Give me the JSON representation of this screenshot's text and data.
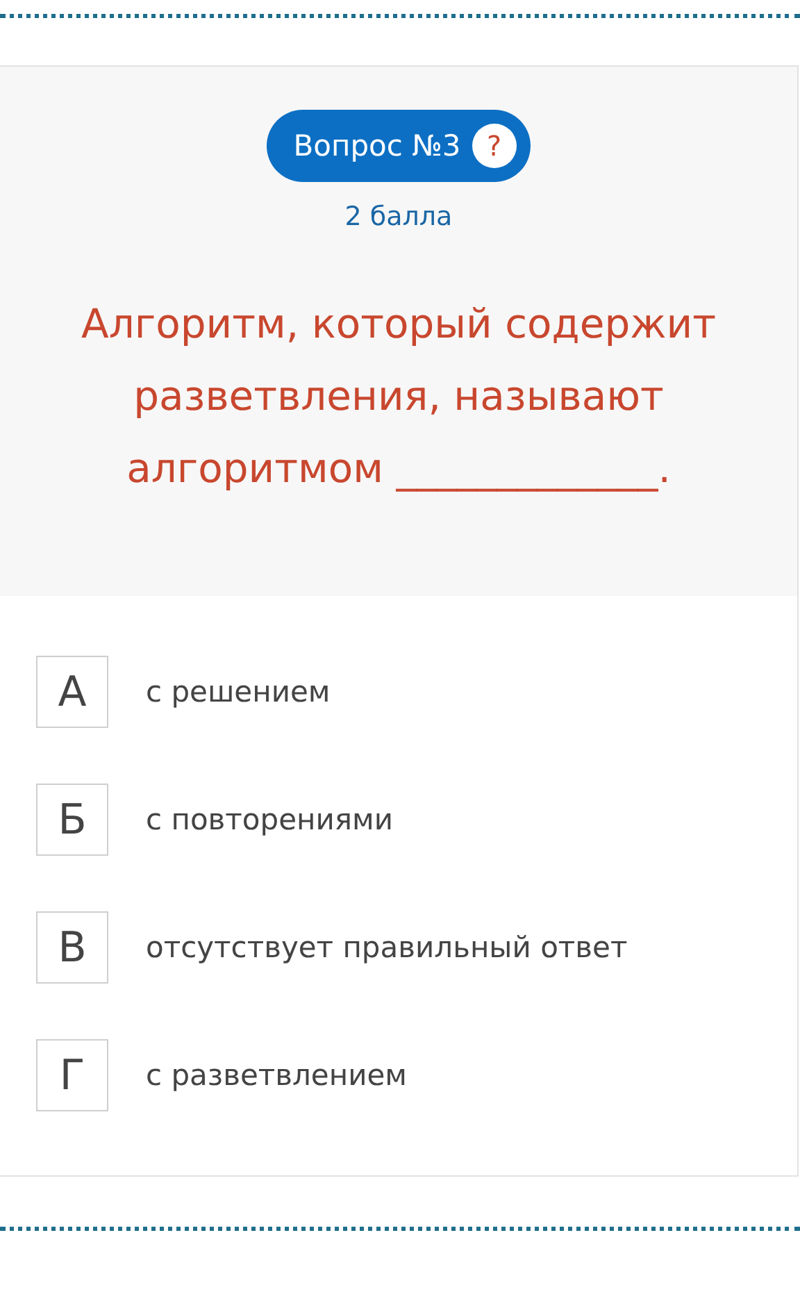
{
  "question": {
    "number_label": "Вопрос №3",
    "help": "?",
    "points": "2 балла",
    "text": "Алгоритм, который содержит разветвления, называют алгоритмом _____________."
  },
  "options": [
    {
      "letter": "А",
      "text": "с решением"
    },
    {
      "letter": "Б",
      "text": "с повторениями"
    },
    {
      "letter": "В",
      "text": "отсутствует правильный ответ"
    },
    {
      "letter": "Г",
      "text": "с разветвлением"
    }
  ]
}
